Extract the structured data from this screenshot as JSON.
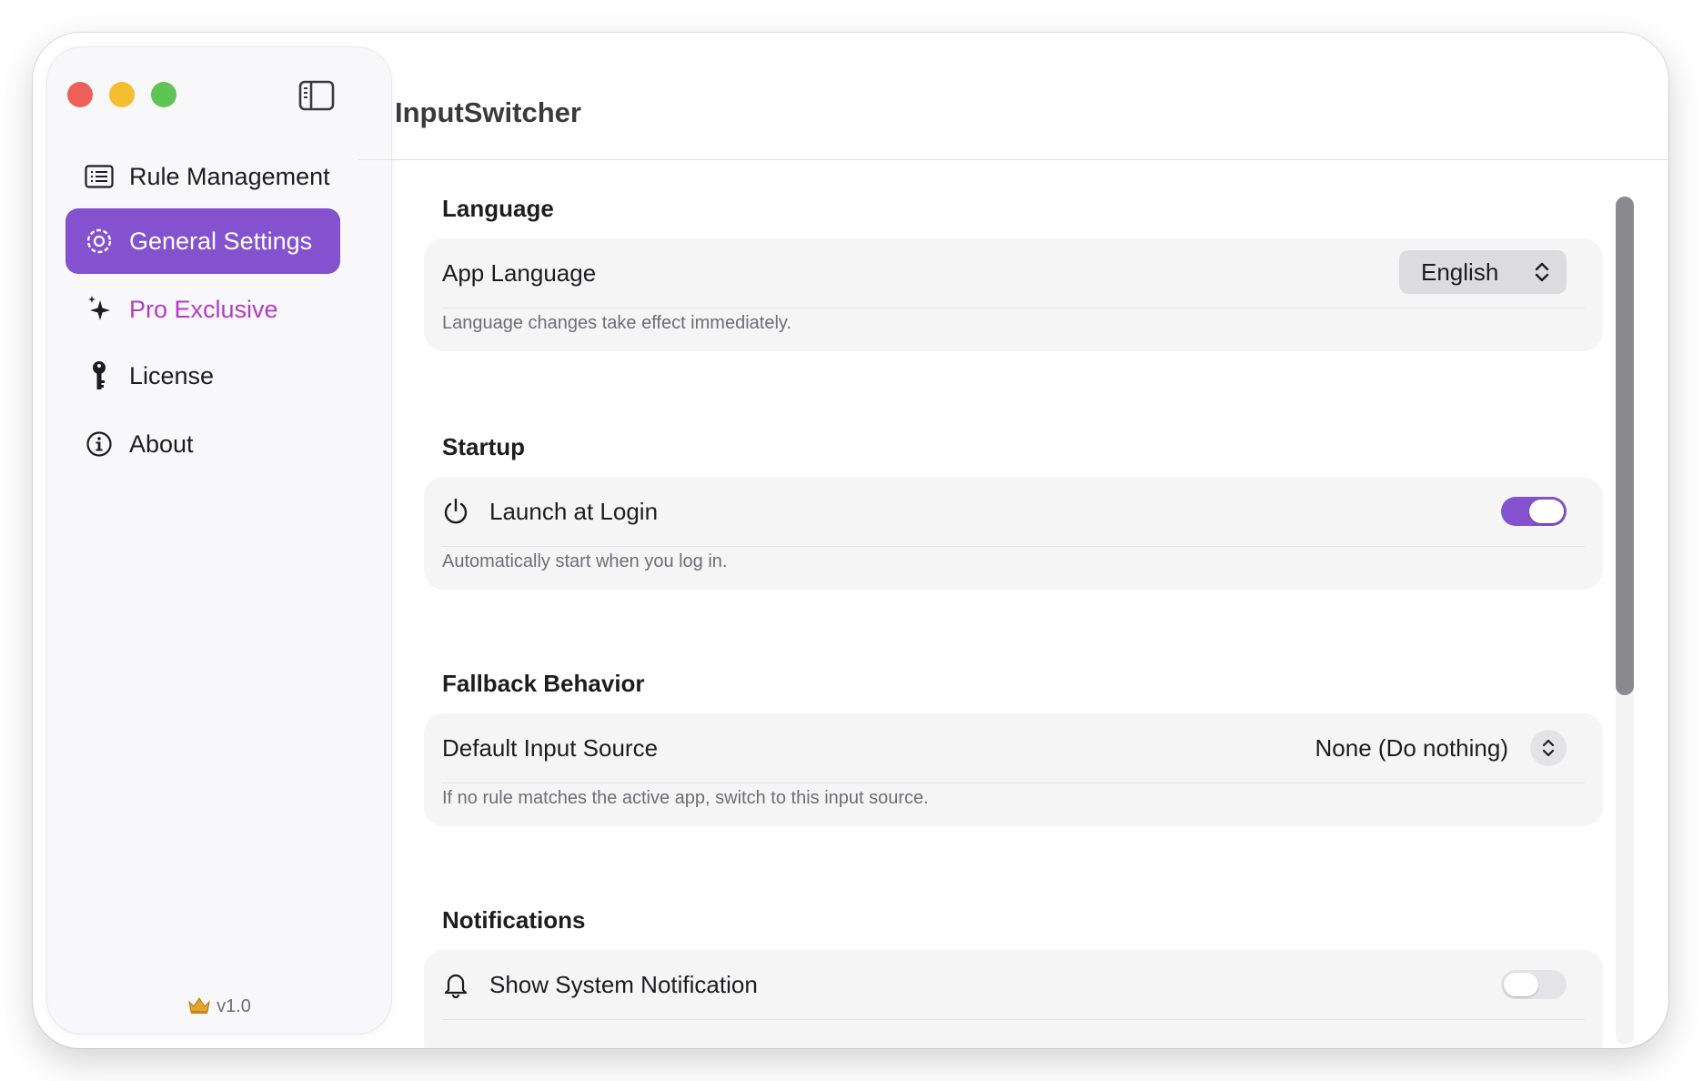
{
  "app": {
    "title": "InputSwitcher",
    "version": "v1.0",
    "version_icon": "crown-icon"
  },
  "colors": {
    "accent": "#8452ce",
    "pro": "#b33cc4",
    "close": "#ee5f57",
    "minimize": "#f5be30",
    "maximize": "#5fc454"
  },
  "sidebar": {
    "items": [
      {
        "label": "Rule Management",
        "icon": "list-icon",
        "active": false
      },
      {
        "label": "General Settings",
        "icon": "gear-icon",
        "active": true
      },
      {
        "label": "Pro Exclusive",
        "icon": "sparkles-icon",
        "active": false
      },
      {
        "label": "License",
        "icon": "key-icon",
        "active": false
      },
      {
        "label": "About",
        "icon": "info-icon",
        "active": false
      }
    ]
  },
  "sections": {
    "language": {
      "title": "Language",
      "row_label": "App Language",
      "value": "English",
      "note": "Language changes take effect immediately."
    },
    "startup": {
      "title": "Startup",
      "row_label": "Launch at Login",
      "enabled": true,
      "note": "Automatically start when you log in."
    },
    "fallback": {
      "title": "Fallback Behavior",
      "row_label": "Default Input Source",
      "value": "None (Do nothing)",
      "note": "If no rule matches the active app, switch to this input source."
    },
    "notifications": {
      "title": "Notifications",
      "row_label": "Show System Notification",
      "enabled": false
    }
  }
}
